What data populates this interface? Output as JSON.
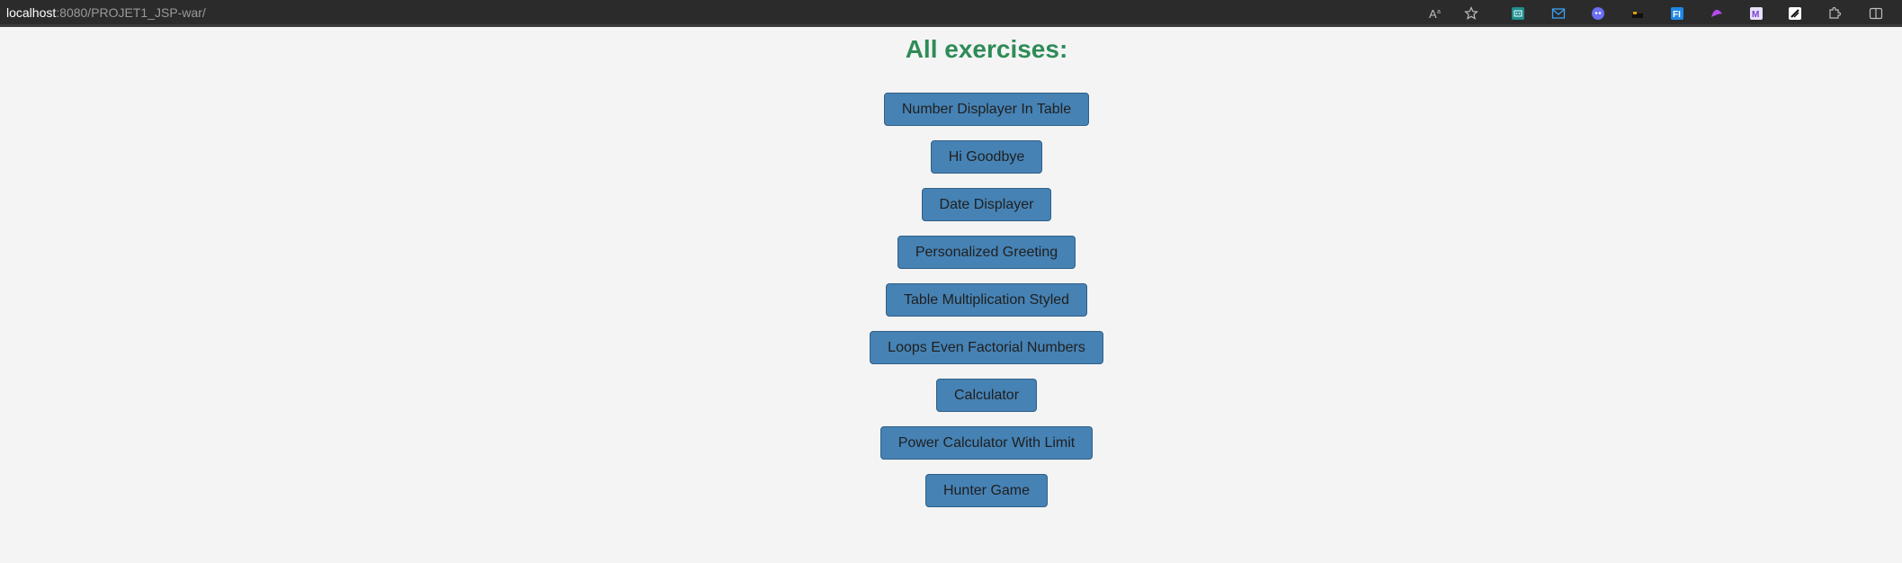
{
  "browser": {
    "url_host": "localhost",
    "url_rest": ":8080/PROJET1_JSP-war/",
    "toolbar_icons": [
      "read-aloud-icon",
      "favorite-star-icon",
      "extension-robot-icon",
      "extension-mail-icon",
      "extension-ghost-icon",
      "extension-dark-icon",
      "extension-fi-icon",
      "extension-curve-icon",
      "extension-m-icon",
      "extension-slash-icon",
      "extensions-puzzle-icon",
      "split-screen-icon"
    ]
  },
  "page": {
    "title": "All exercises:",
    "title_color": "#2e8b57",
    "button_color": "#4682b4",
    "buttons": [
      {
        "label": "Number Displayer In Table"
      },
      {
        "label": "Hi Goodbye"
      },
      {
        "label": "Date Displayer"
      },
      {
        "label": "Personalized Greeting"
      },
      {
        "label": "Table Multiplication Styled"
      },
      {
        "label": "Loops Even Factorial Numbers"
      },
      {
        "label": "Calculator"
      },
      {
        "label": "Power Calculator With Limit"
      },
      {
        "label": "Hunter Game"
      }
    ]
  }
}
